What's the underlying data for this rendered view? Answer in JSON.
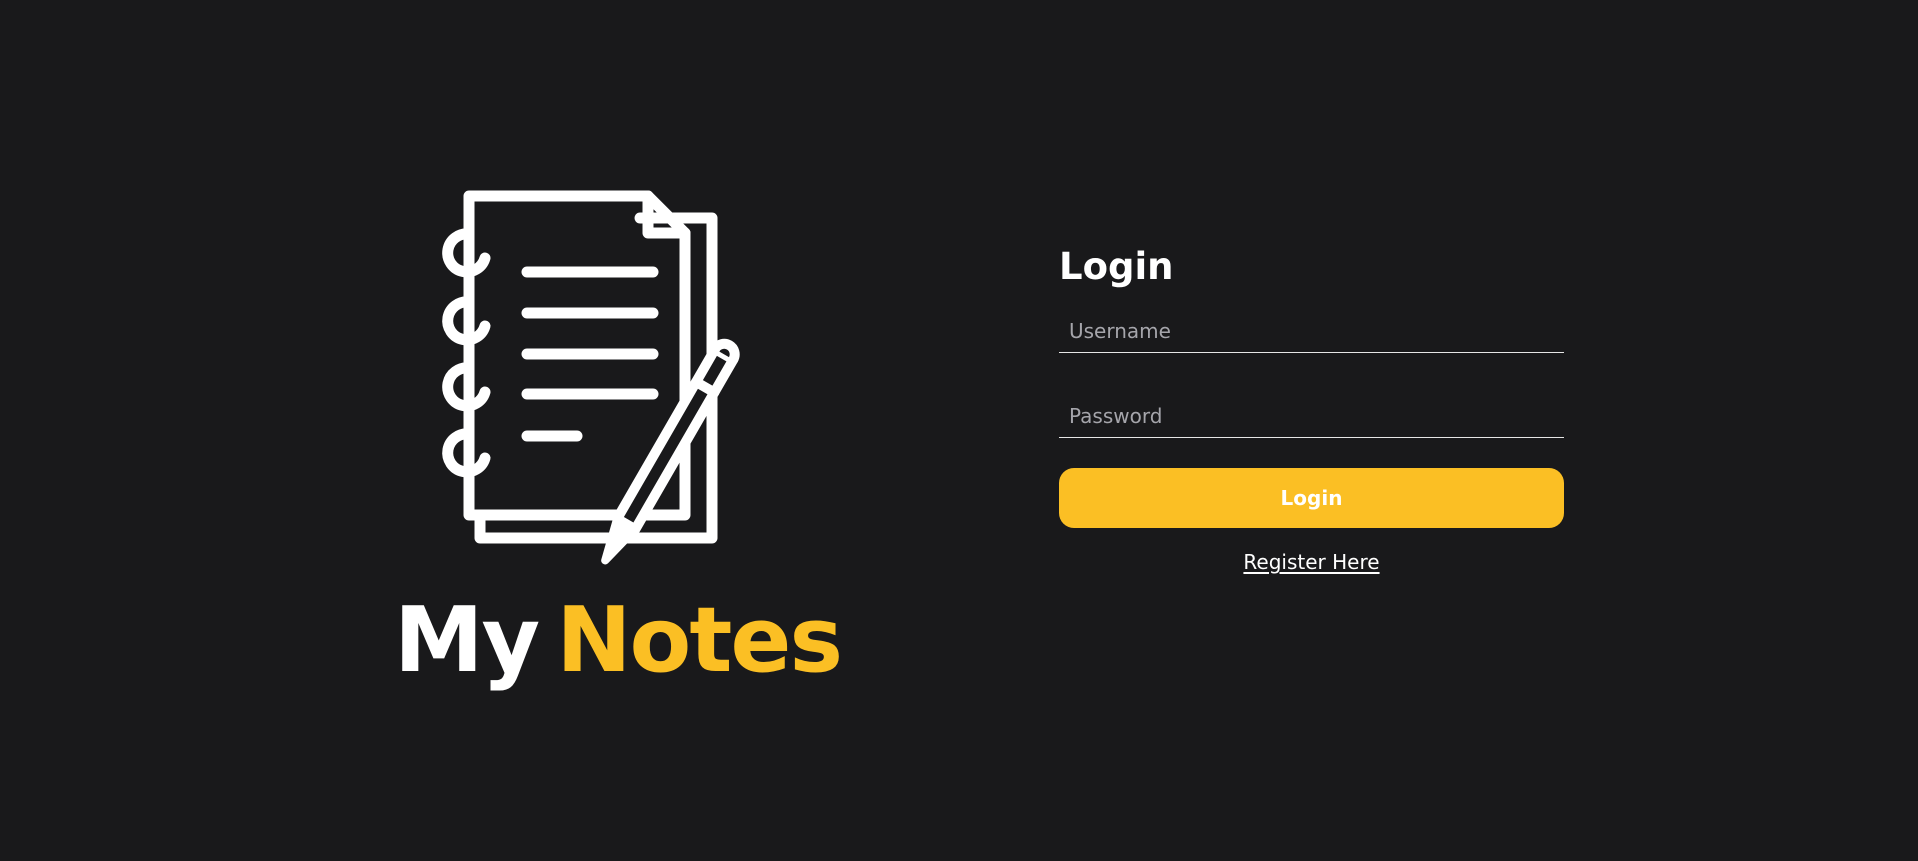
{
  "brand": {
    "icon": "notebook-with-pencil-icon",
    "name_part1": "My",
    "name_part2": "Notes"
  },
  "login": {
    "title": "Login",
    "username_placeholder": "Username",
    "password_placeholder": "Password",
    "username_value": "",
    "password_value": "",
    "submit_label": "Login",
    "register_label": "Register Here"
  },
  "colors": {
    "background": "#19191b",
    "accent": "#fbbf24",
    "text": "#ffffff",
    "placeholder": "#a5a5ab"
  }
}
